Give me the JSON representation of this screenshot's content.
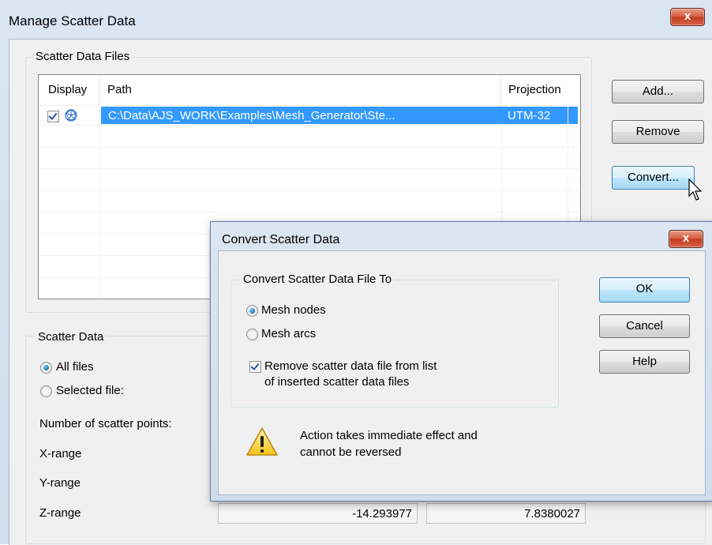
{
  "main_window": {
    "title": "Manage Scatter Data",
    "close_label": "x",
    "files_group": {
      "label": "Scatter Data Files",
      "columns": [
        "Display",
        "Path",
        "Projection"
      ],
      "rows": [
        {
          "display_checked": true,
          "icon": "scatter-network-icon",
          "path": "C:\\Data\\AJS_WORK\\Examples\\Mesh_Generator\\Ste...",
          "projection": "UTM-32"
        }
      ]
    },
    "buttons": {
      "add": "Add...",
      "remove": "Remove",
      "convert": "Convert..."
    },
    "scatter_group": {
      "label": "Scatter Data",
      "all_files": "All files",
      "selected_file": "Selected file:",
      "selected_option": "all_files",
      "num_points_label": "Number of scatter points:",
      "x_range_label": "X-range",
      "y_range_label": "Y-range",
      "z_range_label": "Z-range",
      "z_min": "-14.293977",
      "z_max": "7.8380027"
    }
  },
  "dialog": {
    "title": "Convert Scatter Data",
    "close_label": "x",
    "group_label": "Convert Scatter Data File To",
    "options": [
      "Mesh nodes",
      "Mesh arcs"
    ],
    "selected_option": "Mesh nodes",
    "remove_checkbox_line1": "Remove scatter data file from  list",
    "remove_checkbox_line2": "of inserted scatter data files",
    "remove_checked": true,
    "warning_line1": "Action takes immediate effect and",
    "warning_line2": "cannot be reversed",
    "buttons": {
      "ok": "OK",
      "cancel": "Cancel",
      "help": "Help"
    }
  },
  "colors": {
    "selection": "#3399ff",
    "close_button": "#c23a1e",
    "title_bar": "#dbe6f3"
  }
}
